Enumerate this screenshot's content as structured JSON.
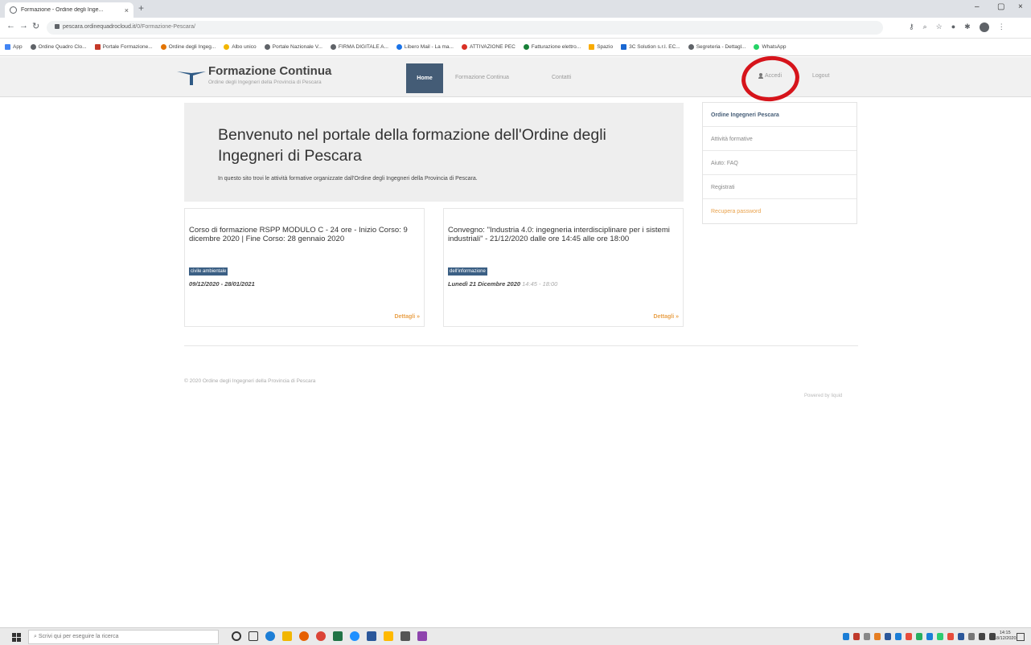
{
  "browser": {
    "tab_title": "Formazione - Ordine degli Inge...",
    "tab_close": "×",
    "new_tab": "+",
    "window_controls": [
      "–",
      "▢",
      "×"
    ],
    "url_host": "pescara.ordinequadrocloud.it",
    "url_path": "/0/Formazione-Pescara/",
    "bookmarks": [
      {
        "label": "App",
        "color": "#4285f4"
      },
      {
        "label": "Ordine Quadro Clo...",
        "color": "#5f6368"
      },
      {
        "label": "Portale Formazione...",
        "color": "#c53929"
      },
      {
        "label": "Ordine degli Ingeg...",
        "color": "#e37400"
      },
      {
        "label": "Albo unico",
        "color": "#f2b600"
      },
      {
        "label": "Portale Nazionale V...",
        "color": "#5f6368"
      },
      {
        "label": "FIRMA DIGITALE A...",
        "color": "#5f6368"
      },
      {
        "label": "Libero Mail - La ma...",
        "color": "#1a73e8"
      },
      {
        "label": "ATTIVAZIONE PEC",
        "color": "#d93025"
      },
      {
        "label": "Fatturazione elettro...",
        "color": "#188038"
      },
      {
        "label": "Spazio",
        "color": "#f9ab00"
      },
      {
        "label": "3C Solution s.r.l. EC...",
        "color": "#1967d2"
      },
      {
        "label": "Segreteria - Dettagl...",
        "color": "#5f6368"
      },
      {
        "label": "WhatsApp",
        "color": "#25d366"
      }
    ]
  },
  "site": {
    "brand_title": "Formazione Continua",
    "brand_subtitle": "Ordine degli Ingegneri della Provincia di Pescara",
    "nav": {
      "home": "Home",
      "formazione": "Formazione Continua",
      "contatti": "Contatti",
      "accedi": "Accedi",
      "logout": "Logout"
    },
    "jumbotron": {
      "title": "Benvenuto nel portale della formazione dell'Ordine degli Ingegneri di Pescara",
      "text": "In questo sito trovi le attività formative organizzate dall'Ordine degli Ingegneri della Provincia di Pescara."
    },
    "sidebar": [
      "Ordine Ingegneri Pescara",
      "Attività formative",
      "Aiuto: FAQ",
      "Registrati",
      "Recupera password"
    ],
    "events": [
      {
        "title": "Corso di formazione RSPP MODULO C - 24 ore - Inizio Corso: 9 dicembre 2020 | Fine Corso: 28 gennaio 2020",
        "tag": "civile ambientale",
        "date": "09/12/2020 - 28/01/2021",
        "time": "",
        "more": "Dettagli »"
      },
      {
        "title": "Convegno: \"Industria 4.0: ingegneria interdisciplinare per i sistemi industriali\" - 21/12/2020 dalle ore 14:45 alle ore 18:00",
        "tag": "dell'informazione",
        "date": "Lunedì 21 Dicembre 2020",
        "time": "14:45 - 18:00",
        "more": "Dettagli »"
      }
    ],
    "footer_left": "© 2020 Ordine degli Ingegneri della Provincia di Pescara",
    "footer_right": "Powered by liquid"
  },
  "taskbar": {
    "search_placeholder": "Scrivi qui per eseguire la ricerca",
    "clock_time": "14:15",
    "clock_date": "18/12/2020"
  }
}
